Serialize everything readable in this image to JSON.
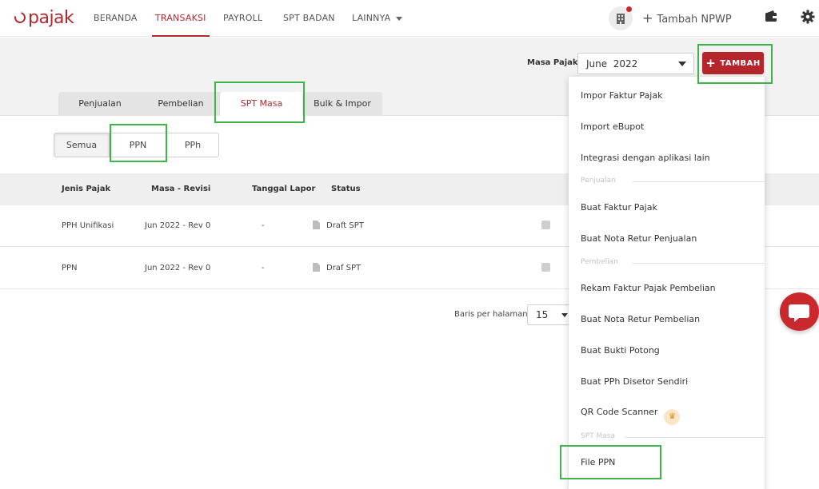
{
  "brand": {
    "logo_text": "pajak",
    "accent_color": "#b22a2e",
    "highlight_color": "#3db54a"
  },
  "nav": {
    "items": [
      {
        "label": "BERANDA",
        "active": false
      },
      {
        "label": "TRANSAKSI",
        "active": true
      },
      {
        "label": "PAYROLL",
        "active": false
      },
      {
        "label": "SPT BADAN",
        "active": false
      },
      {
        "label": "LAINNYA",
        "active": false
      }
    ],
    "npwp_label": "Tambah NPWP",
    "icons": [
      "company-icon",
      "wallet-icon",
      "gear-icon"
    ]
  },
  "filter": {
    "masa_label": "Masa Pajak",
    "masa_value": "June  2022",
    "tambah_label": "TAMBAH"
  },
  "tabs": [
    {
      "label": "Penjualan",
      "active": false
    },
    {
      "label": "Pembelian",
      "active": false
    },
    {
      "label": "SPT Masa",
      "active": true
    },
    {
      "label": "Bulk & Impor",
      "active": false
    }
  ],
  "segments": [
    {
      "label": "Semua",
      "active": true
    },
    {
      "label": "PPN",
      "active": false
    },
    {
      "label": "PPh",
      "active": false
    }
  ],
  "table": {
    "columns": [
      "Jenis Pajak",
      "Masa - Revisi",
      "Tanggal Lapor",
      "Status"
    ],
    "rows": [
      {
        "jenis": "PPH Unifikasi",
        "masa": "Jun 2022 - Rev 0",
        "tanggal": "-",
        "status": "Draft SPT"
      },
      {
        "jenis": "PPN",
        "masa": "Jun 2022 - Rev 0",
        "tanggal": "-",
        "status": "Draf SPT"
      }
    ]
  },
  "pagination": {
    "label": "Baris per halaman:",
    "value": "15"
  },
  "dropdown": {
    "items_top": [
      "Impor Faktur Pajak",
      "Import eBupot",
      "Integrasi dengan aplikasi lain"
    ],
    "section_penjualan": "Penjualan",
    "items_penjualan": [
      "Buat Faktur Pajak",
      "Buat Nota Retur Penjualan"
    ],
    "section_pembelian": "Pembelian",
    "items_pembelian": [
      "Rekam Faktur Pajak Pembelian",
      "Buat Nota Retur Pembelian",
      "Buat Bukti Potong",
      "Buat PPh Disetor Sendiri",
      "QR Code Scanner"
    ],
    "section_spt": "SPT Masa",
    "items_spt": [
      "File PPN"
    ]
  }
}
